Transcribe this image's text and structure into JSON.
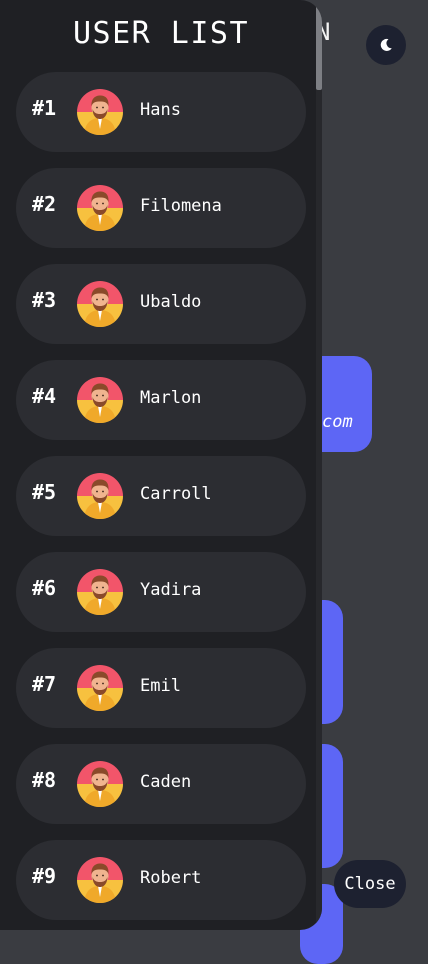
{
  "background": {
    "title_fragment": "N",
    "email_fragment": "com",
    "theme_toggle_icon": "moon-icon"
  },
  "drawer": {
    "title": "USER LIST",
    "users": [
      {
        "rank": "#1",
        "name": "Hans"
      },
      {
        "rank": "#2",
        "name": "Filomena"
      },
      {
        "rank": "#3",
        "name": "Ubaldo"
      },
      {
        "rank": "#4",
        "name": "Marlon"
      },
      {
        "rank": "#5",
        "name": "Carroll"
      },
      {
        "rank": "#6",
        "name": "Yadira"
      },
      {
        "rank": "#7",
        "name": "Emil"
      },
      {
        "rank": "#8",
        "name": "Caden"
      },
      {
        "rank": "#9",
        "name": "Robert"
      }
    ]
  },
  "close_label": "Close",
  "colors": {
    "accent": "#5d66f5",
    "drawer_bg": "#1f2024",
    "item_bg": "#2c2d32",
    "page_bg": "#3a3c41"
  }
}
